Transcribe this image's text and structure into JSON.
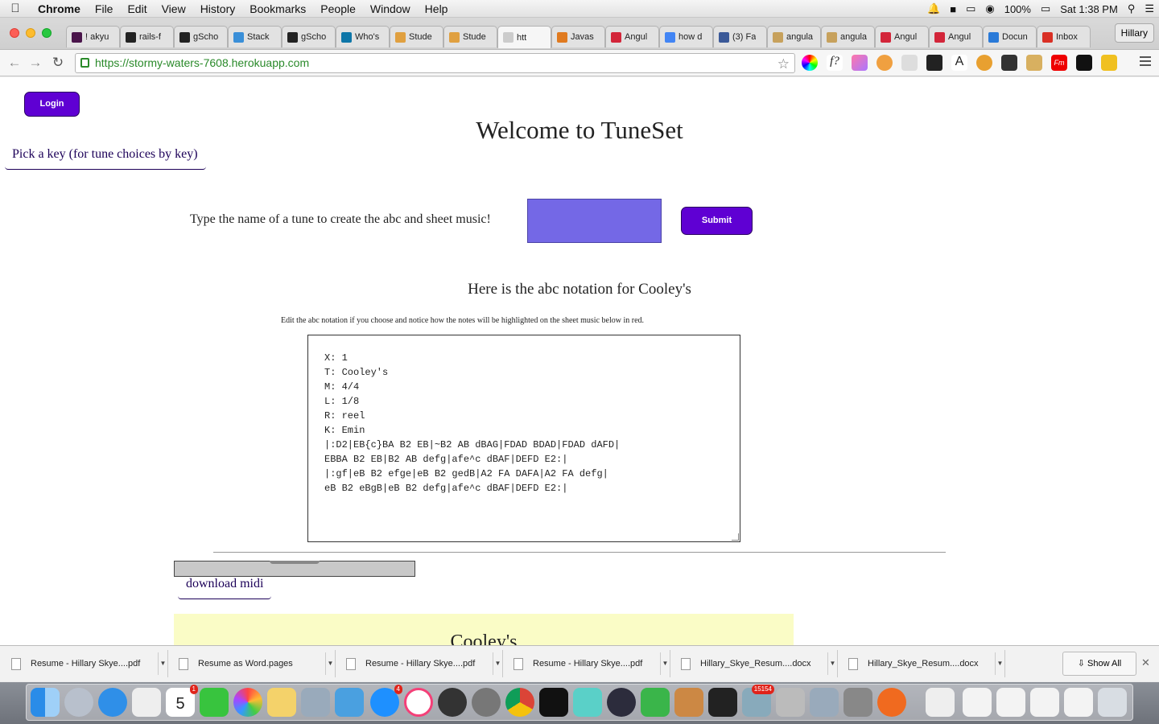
{
  "menubar": {
    "apple": "",
    "app": "Chrome",
    "menus": [
      "File",
      "Edit",
      "View",
      "History",
      "Bookmarks",
      "People",
      "Window",
      "Help"
    ],
    "battery": "100%",
    "clock": "Sat 1:38 PM"
  },
  "tabs": [
    {
      "label": "! akyu",
      "icon": "slack-icon",
      "color": "#4a154b"
    },
    {
      "label": "rails-f",
      "icon": "github-icon",
      "color": "#222222"
    },
    {
      "label": "gScho",
      "icon": "github-icon",
      "color": "#222222"
    },
    {
      "label": "Stack",
      "icon": "stackoverflow-icon",
      "color": "#3a8fd8"
    },
    {
      "label": "gScho",
      "icon": "github-icon",
      "color": "#222222"
    },
    {
      "label": "Who's",
      "icon": "linkedin-icon",
      "color": "#0e76a8"
    },
    {
      "label": "Stude",
      "icon": "hand-icon",
      "color": "#e0a040"
    },
    {
      "label": "Stude",
      "icon": "hand-icon",
      "color": "#e0a040"
    },
    {
      "label": "htt",
      "icon": "page-icon",
      "color": "#cccccc"
    },
    {
      "label": "Javas",
      "icon": "js-icon",
      "color": "#e07a1f"
    },
    {
      "label": "Angul",
      "icon": "angular-icon",
      "color": "#d3263a"
    },
    {
      "label": "how d",
      "icon": "google-icon",
      "color": "#4285f4"
    },
    {
      "label": "(3) Fa",
      "icon": "facebook-icon",
      "color": "#3b5998"
    },
    {
      "label": "angula",
      "icon": "stack-icon",
      "color": "#c7a15c"
    },
    {
      "label": "angula",
      "icon": "stack-icon",
      "color": "#c7a15c"
    },
    {
      "label": "Angul",
      "icon": "angular-icon",
      "color": "#d3263a"
    },
    {
      "label": "Angul",
      "icon": "angular-icon",
      "color": "#d3263a"
    },
    {
      "label": "Docun",
      "icon": "docs-icon",
      "color": "#2a7ad8"
    },
    {
      "label": "Inbox",
      "icon": "gmail-icon",
      "color": "#d93025"
    }
  ],
  "profile": "Hillary",
  "url": "https://stormy-waters-7608.herokuapp.com",
  "page": {
    "login_label": "Login",
    "title": "Welcome to TuneSet",
    "pick_key": "Pick a key (for tune choices by key)",
    "prompt": "Type the name of a tune to create the abc and sheet music!",
    "tune_input_value": "",
    "submit_label": "Submit",
    "abc_heading": "Here is the abc notation for Cooley's",
    "abc_note": "Edit the abc notation if you choose and notice how the notes will be highlighted on the sheet music below in red.",
    "abc_text": "X: 1\nT: Cooley's\nM: 4/4\nL: 1/8\nR: reel\nK: Emin\n|:D2|EB{c}BA B2 EB|~B2 AB dBAG|FDAD BDAD|FDAD dAFD|\nEBBA B2 EB|B2 AB defg|afe^c dBAF|DEFD E2:|\n|:gf|eB B2 efge|eB B2 gedB|A2 FA DAFA|A2 FA defg|\neB B2 eBgB|eB B2 defg|afe^c dBAF|DEFD E2:|",
    "download_midi": "download midi",
    "sheet_title": "Cooley's"
  },
  "downloads": [
    "Resume - Hillary Skye....pdf",
    "Resume as Word.pages",
    "Resume - Hillary Skye....pdf",
    "Resume - Hillary Skye....pdf",
    "Hillary_Skye_Resum....docx",
    "Hillary_Skye_Resum....docx"
  ],
  "show_all": "Show All",
  "dock_badges": {
    "calendar_day": "5",
    "calendar_badge": "1",
    "appstore_badge": "4",
    "photos_badge": "15154"
  }
}
